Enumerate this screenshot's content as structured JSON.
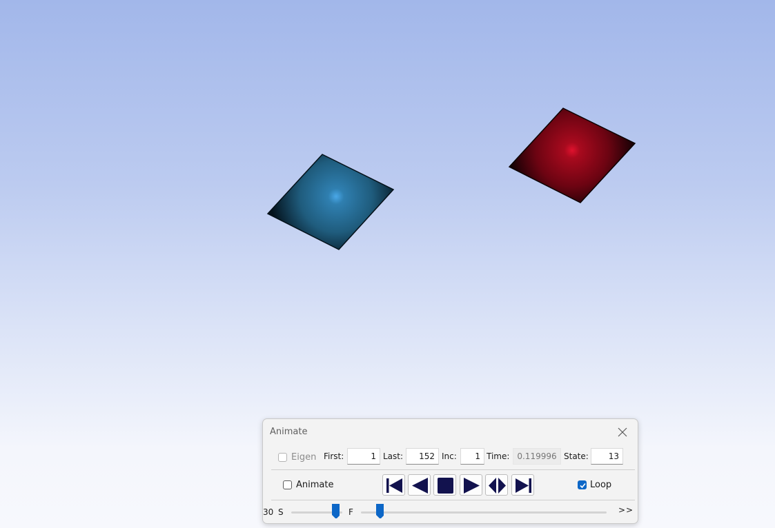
{
  "scene": {
    "background_top": "#a2b7ea",
    "background_bottom": "#f7f8fd",
    "plates": [
      {
        "name": "blue-plate",
        "color": "#2a6e96",
        "highlight": "#4aa3e0"
      },
      {
        "name": "red-plate",
        "color": "#8a0717",
        "highlight": "#d4102a"
      }
    ]
  },
  "dialog": {
    "title": "Animate",
    "close_icon": "close-icon",
    "row1": {
      "eigen_label": "Eigen",
      "eigen_checked": false,
      "eigen_enabled": false,
      "first_label": "First:",
      "first_value": "1",
      "last_label": "Last:",
      "last_value": "152",
      "inc_label": "Inc:",
      "inc_value": "1",
      "time_label": "Time:",
      "time_value": "0.119996",
      "state_label": "State:",
      "state_value": "13"
    },
    "row2": {
      "animate_label": "Animate",
      "animate_checked": false,
      "transport": [
        {
          "name": "skip-to-first-icon"
        },
        {
          "name": "step-backward-icon"
        },
        {
          "name": "stop-icon"
        },
        {
          "name": "play-icon"
        },
        {
          "name": "bounce-icon"
        },
        {
          "name": "skip-to-last-icon"
        }
      ],
      "loop_label": "Loop",
      "loop_checked": true
    },
    "row3": {
      "speed_value_label": "30",
      "slow_label": "S",
      "fast_label": "F",
      "speed_slider_fraction": 0.88,
      "frame_slider_fraction": 0.08,
      "more_label": ">>"
    },
    "accent_color": "#0d67c7",
    "button_glyph_color": "#12124e"
  }
}
